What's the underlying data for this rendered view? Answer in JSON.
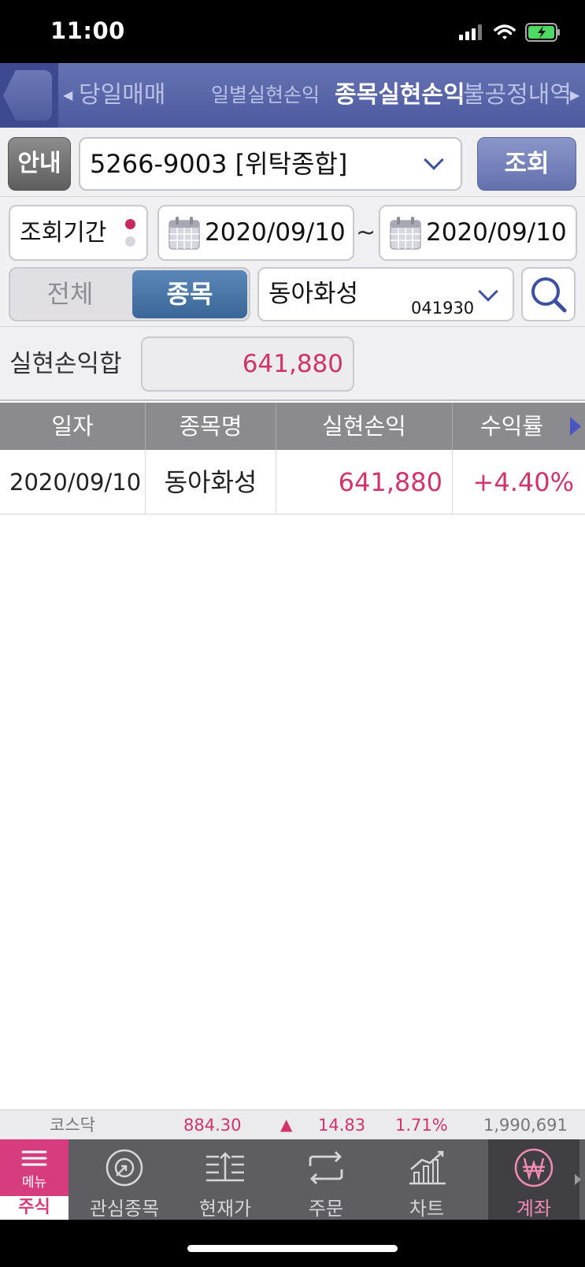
{
  "status_bar": {
    "time": "11:00"
  },
  "nav": {
    "tabs": [
      {
        "label": "당일매매"
      },
      {
        "label": "일별실현손익"
      },
      {
        "label": "종목실현손익"
      },
      {
        "label": "불공정내역"
      }
    ],
    "active_tab": "종목실현손익"
  },
  "account": {
    "info_button": "안내",
    "selected": "5266-9003 [위탁종합]",
    "search_button": "조회"
  },
  "period": {
    "label": "조회기간",
    "start_date": "2020/09/10",
    "separator": "~",
    "end_date": "2020/09/10"
  },
  "filter": {
    "all_label": "전체",
    "item_label": "종목",
    "stock_name": "동아화성",
    "stock_code": "041930"
  },
  "summary": {
    "label": "실현손익합",
    "value": "641,880"
  },
  "table": {
    "headers": [
      "일자",
      "종목명",
      "실현손익",
      "수익률"
    ],
    "rows": [
      {
        "date": "2020/09/10",
        "name": "동아화성",
        "profit": "641,880",
        "rate": "+4.40%"
      }
    ]
  },
  "ticker": {
    "index_name": "코스닥",
    "value": "884.30",
    "change": "14.83",
    "change_pct": "1.71%",
    "volume": "1,990,691"
  },
  "bottom_nav": {
    "menu_label": "메뉴",
    "menu_sub": "주식",
    "items": [
      {
        "label": "관심종목"
      },
      {
        "label": "현재가"
      },
      {
        "label": "주문"
      },
      {
        "label": "차트"
      },
      {
        "label": "계좌"
      }
    ]
  },
  "colors": {
    "accent": "#d2336b",
    "nav": "#4c599e",
    "active_toggle": "#3b6798"
  }
}
